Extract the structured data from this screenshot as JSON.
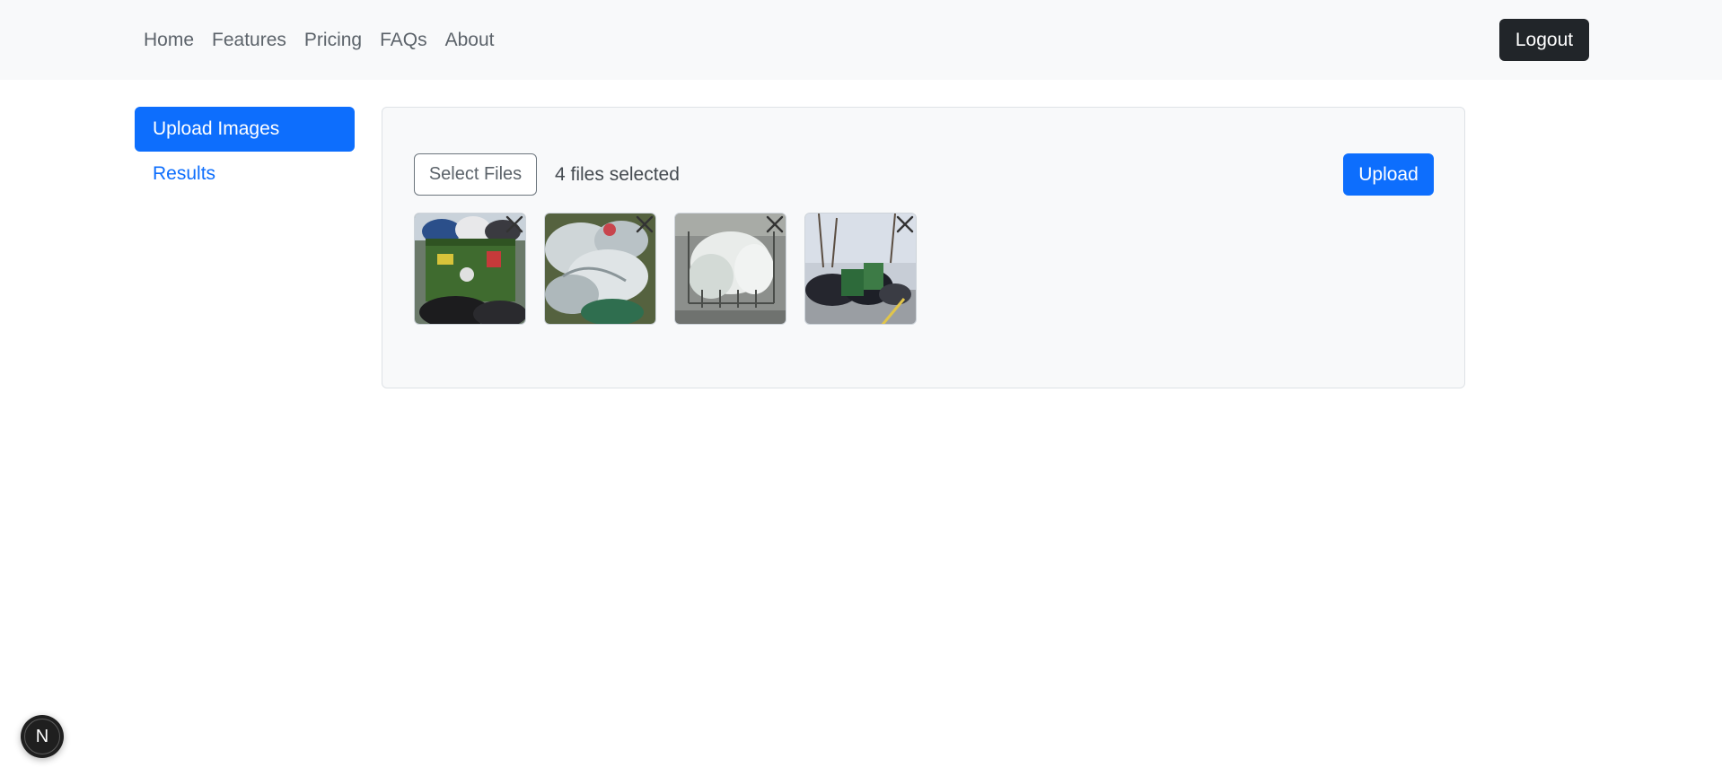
{
  "nav": {
    "links": [
      "Home",
      "Features",
      "Pricing",
      "FAQs",
      "About"
    ],
    "logout_label": "Logout"
  },
  "sidebar": {
    "items": [
      {
        "label": "Upload Images",
        "active": true
      },
      {
        "label": "Results",
        "active": false
      }
    ]
  },
  "upload": {
    "select_label": "Select Files",
    "files_selected": "4 files selected",
    "upload_label": "Upload",
    "thumbnails": [
      {
        "subject": "green wheelie bin overflowing with trash bags",
        "remove_icon": "close-icon"
      },
      {
        "subject": "pile of plastic bags",
        "remove_icon": "close-icon"
      },
      {
        "subject": "shopping cart filled with plastic bags",
        "remove_icon": "close-icon"
      },
      {
        "subject": "street with piled garbage bags and bins",
        "remove_icon": "close-icon"
      }
    ]
  },
  "badge": {
    "letter": "N",
    "icon": "nextjs-logo-icon"
  },
  "colors": {
    "primary": "#0d6efd",
    "dark": "#212529",
    "navbar_bg": "#f8f9fa",
    "panel_bg": "#f8f9fa",
    "muted_text": "#5c636a"
  }
}
